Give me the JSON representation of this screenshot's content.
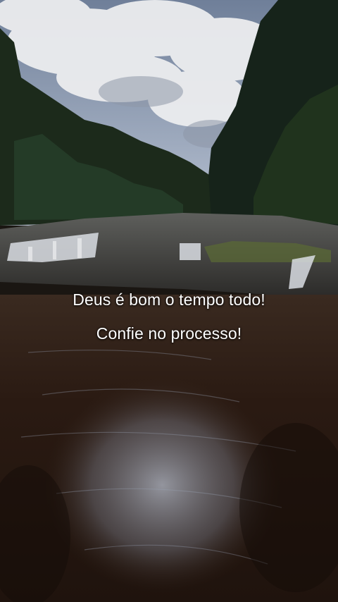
{
  "overlay": {
    "line1": "Deus é bom o tempo todo!",
    "line2": "Confie no processo!"
  },
  "scene": {
    "description_icon": "waterfall-landscape-photo",
    "colors": {
      "sky": "#8f9db2",
      "clouds": "#e9eaed",
      "forest": "#1c2a1b",
      "rock": "#4a4a48",
      "water": "#2a1a12",
      "reflection": "#9aa4b6"
    }
  }
}
